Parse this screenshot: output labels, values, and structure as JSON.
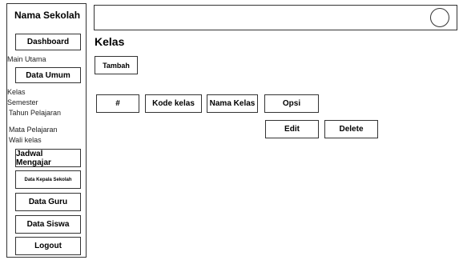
{
  "sidebar": {
    "school_name": "Nama Sekolah",
    "dashboard": "Dashboard",
    "main_utama": "Main Utama",
    "data_umum": "Data Umum",
    "data_umum_items": [
      "Kelas",
      "Semester",
      "Tahun Pelajaran",
      "Mata Pelajaran",
      "Wali kelas"
    ],
    "jadwal_mengajar": "Jadwal Mengajar",
    "data_kepala_sekolah": "Data Kepala Sekolah",
    "data_guru": "Data Guru",
    "data_siswa": "Data Siswa",
    "logout": "Logout"
  },
  "main": {
    "title": "Kelas",
    "add_button": "Tambah",
    "table": {
      "headers": [
        "#",
        "Kode kelas",
        "Nama Kelas",
        "Opsi"
      ],
      "actions": [
        "Edit",
        "Delete"
      ]
    }
  }
}
